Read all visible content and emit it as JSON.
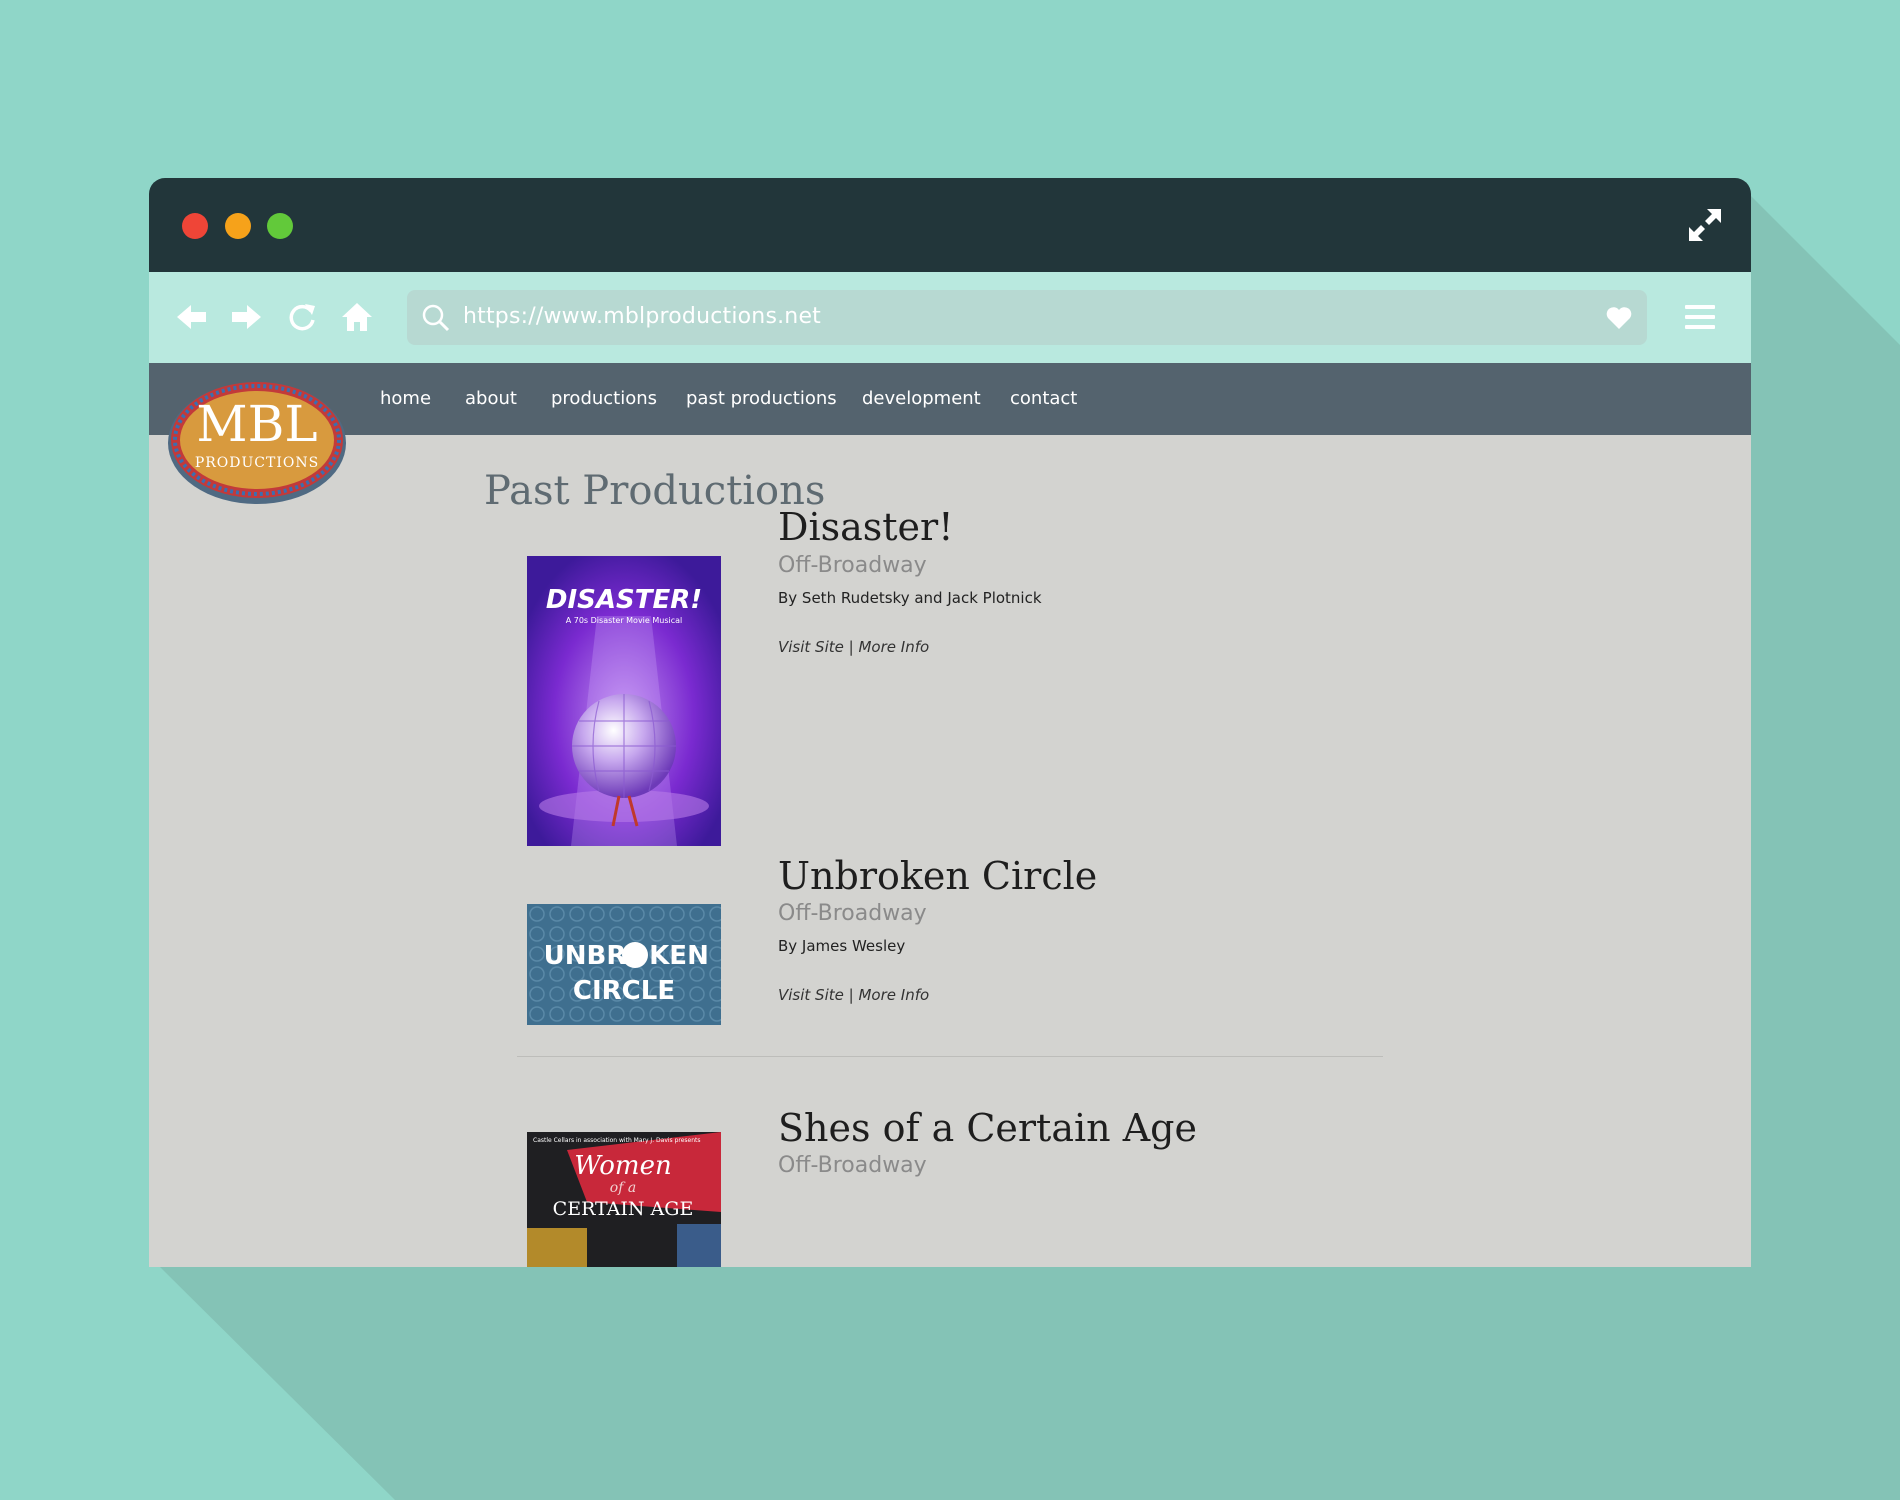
{
  "browser": {
    "url": "https://www.mblproductions.net",
    "icons": {
      "window_controls": [
        "close-dot",
        "minimize-dot",
        "maximize-dot"
      ],
      "expand": "expand-icon",
      "back": "arrow-left-icon",
      "forward": "arrow-right-icon",
      "reload": "reload-icon",
      "home": "home-icon",
      "search": "search-icon",
      "favorite": "heart-icon",
      "menu": "hamburger-menu-icon"
    }
  },
  "site": {
    "logo": {
      "main": "MBL",
      "sub": "PRODUCTIONS"
    },
    "nav": [
      "home",
      "about",
      "productions",
      "past productions",
      "development",
      "contact"
    ],
    "page_title": "Past Productions"
  },
  "productions": [
    {
      "title": "Disaster!",
      "venue": "Off-Broadway",
      "credit": "By Seth Rudetsky and Jack Plotnick",
      "visit_label": "Visit Site",
      "separator": "|",
      "info_label": "More Info",
      "poster": {
        "headline": "DISASTER!",
        "tagline": "A 70s Disaster Movie Musical"
      }
    },
    {
      "title": "Unbroken Circle",
      "venue": "Off-Broadway",
      "credit": "By James Wesley",
      "visit_label": "Visit Site",
      "separator": "|",
      "info_label": "More Info",
      "poster": {
        "line1_a": "UNBR",
        "line1_b": "KEN",
        "line2": "CIRCLE"
      }
    },
    {
      "title": "Shes of a Certain Age",
      "venue": "Off-Broadway",
      "poster": {
        "top": "Castle Cellars in association with Mary J. Davis presents",
        "script": "Women",
        "of": "of a",
        "bottom": "CERTAIN AGE"
      }
    }
  ],
  "colors": {
    "background": "#8fd6c8",
    "titlebar": "#22363a",
    "toolbar": "#b9e9df",
    "nav": "#54636e",
    "page": "#d3d3d0"
  }
}
